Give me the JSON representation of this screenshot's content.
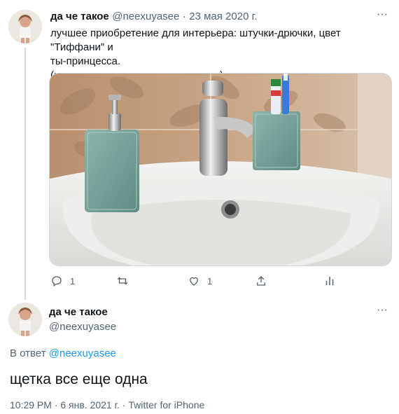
{
  "tweet1": {
    "display_name": "да че такое",
    "handle": "@neexuyasee",
    "separator": "·",
    "date": "23 мая 2020 г.",
    "more_label": "···",
    "text_line1": "лучшее приобретение для интерьера: штучки-дрючки, цвет \"Тиффани\" и",
    "text_line2": "ты-принцесса.",
    "text_line3": "(ну и что, что щетка одна, это пока)",
    "actions": {
      "reply_count": "1",
      "retweet_count": "",
      "like_count": "1"
    }
  },
  "tweet2": {
    "display_name": "да че такое",
    "handle": "@neexuyasee",
    "more_label": "···",
    "reply_prefix": "В ответ",
    "reply_to": "@neexuyasee",
    "text": "щетка все еще одна",
    "timestamp": "10:29 PM · 6 янв. 2021 г. · Twitter for iPhone"
  },
  "colors": {
    "link": "#1d9bf0",
    "muted": "#536471",
    "tiffany": "#7fa7a0"
  },
  "icons": [
    "reply-icon",
    "retweet-icon",
    "like-icon",
    "share-icon",
    "analytics-icon"
  ]
}
